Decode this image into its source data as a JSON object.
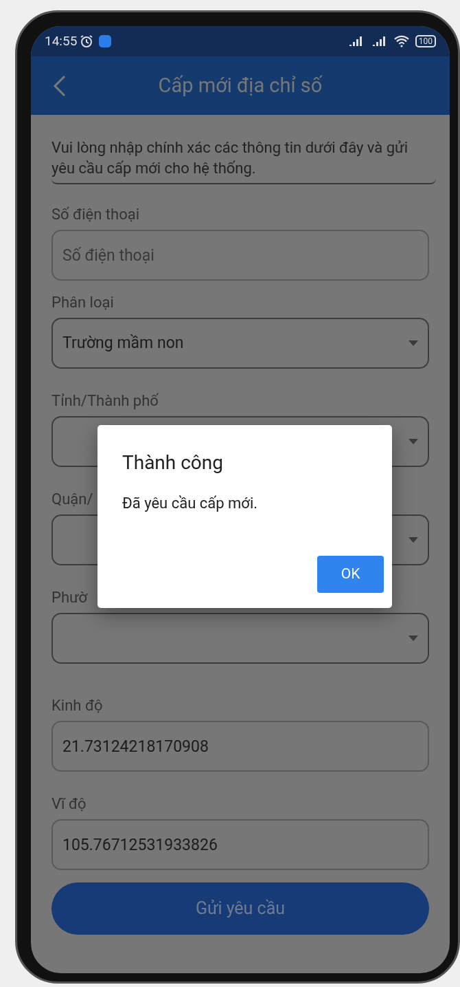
{
  "status_bar": {
    "time": "14:55",
    "battery": "100"
  },
  "header": {
    "title": "Cấp mới địa chỉ số"
  },
  "intro": "Vui lòng nhập chính xác các thông tin dưới đây và gửi yêu cầu cấp mới cho hệ thống.",
  "fields": [
    {
      "label": "Số điện thoại",
      "kind": "input",
      "placeholder": "Số điện thoại"
    },
    {
      "label": "Phân loại",
      "kind": "select",
      "value": "Trường mầm non"
    },
    {
      "label": "Tỉnh/Thành phố",
      "kind": "select"
    },
    {
      "label": "Quận/",
      "kind": "select"
    },
    {
      "label": "Phườ",
      "kind": "select"
    },
    {
      "label": "Kinh độ",
      "kind": "input",
      "value": "21.73124218170908"
    },
    {
      "label": "Vĩ độ",
      "kind": "input",
      "value": "105.76712531933826"
    }
  ],
  "submit_button": "Gửi yêu cầu",
  "dialog": {
    "title": "Thành công",
    "message": "Đã yêu cầu cấp mới.",
    "button": "OK"
  }
}
